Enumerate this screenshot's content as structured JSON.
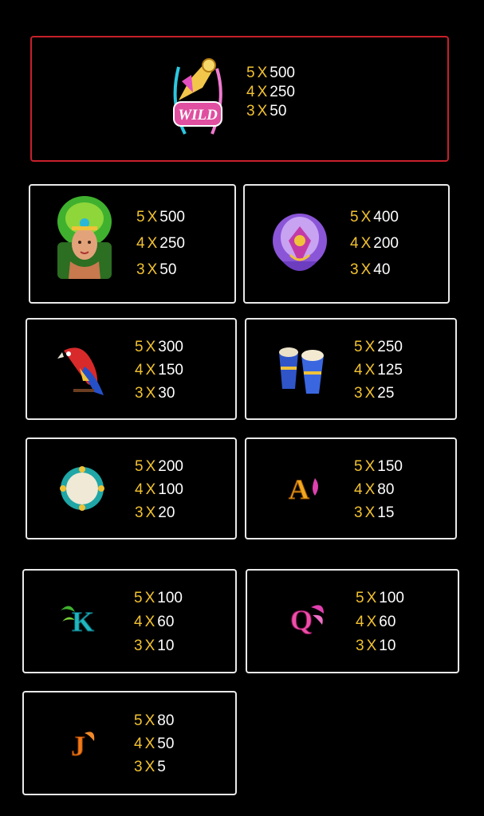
{
  "paytable": [
    {
      "symbol": "wild-icon",
      "label": "WILD",
      "pays": [
        {
          "count": "5",
          "multiplier": "X",
          "value": "500"
        },
        {
          "count": "4",
          "multiplier": "X",
          "value": "250"
        },
        {
          "count": "3",
          "multiplier": "X",
          "value": "50"
        }
      ]
    },
    {
      "symbol": "carnival-dancer-icon",
      "pays": [
        {
          "count": "5",
          "multiplier": "X",
          "value": "500"
        },
        {
          "count": "4",
          "multiplier": "X",
          "value": "250"
        },
        {
          "count": "3",
          "multiplier": "X",
          "value": "50"
        }
      ]
    },
    {
      "symbol": "feather-headdress-icon",
      "pays": [
        {
          "count": "5",
          "multiplier": "X",
          "value": "400"
        },
        {
          "count": "4",
          "multiplier": "X",
          "value": "200"
        },
        {
          "count": "3",
          "multiplier": "X",
          "value": "40"
        }
      ]
    },
    {
      "symbol": "parrot-icon",
      "pays": [
        {
          "count": "5",
          "multiplier": "X",
          "value": "300"
        },
        {
          "count": "4",
          "multiplier": "X",
          "value": "150"
        },
        {
          "count": "3",
          "multiplier": "X",
          "value": "30"
        }
      ]
    },
    {
      "symbol": "conga-drums-icon",
      "pays": [
        {
          "count": "5",
          "multiplier": "X",
          "value": "250"
        },
        {
          "count": "4",
          "multiplier": "X",
          "value": "125"
        },
        {
          "count": "3",
          "multiplier": "X",
          "value": "25"
        }
      ]
    },
    {
      "symbol": "tambourine-icon",
      "pays": [
        {
          "count": "5",
          "multiplier": "X",
          "value": "200"
        },
        {
          "count": "4",
          "multiplier": "X",
          "value": "100"
        },
        {
          "count": "3",
          "multiplier": "X",
          "value": "20"
        }
      ]
    },
    {
      "symbol": "letter-a-icon",
      "label": "A",
      "pays": [
        {
          "count": "5",
          "multiplier": "X",
          "value": "150"
        },
        {
          "count": "4",
          "multiplier": "X",
          "value": "80"
        },
        {
          "count": "3",
          "multiplier": "X",
          "value": "15"
        }
      ]
    },
    {
      "symbol": "letter-k-icon",
      "label": "K",
      "pays": [
        {
          "count": "5",
          "multiplier": "X",
          "value": "100"
        },
        {
          "count": "4",
          "multiplier": "X",
          "value": "60"
        },
        {
          "count": "3",
          "multiplier": "X",
          "value": "10"
        }
      ]
    },
    {
      "symbol": "letter-q-icon",
      "label": "Q",
      "pays": [
        {
          "count": "5",
          "multiplier": "X",
          "value": "100"
        },
        {
          "count": "4",
          "multiplier": "X",
          "value": "60"
        },
        {
          "count": "3",
          "multiplier": "X",
          "value": "10"
        }
      ]
    },
    {
      "symbol": "letter-j-icon",
      "label": "J",
      "pays": [
        {
          "count": "5",
          "multiplier": "X",
          "value": "80"
        },
        {
          "count": "4",
          "multiplier": "X",
          "value": "50"
        },
        {
          "count": "3",
          "multiplier": "X",
          "value": "5"
        }
      ]
    }
  ],
  "colors": {
    "count_color": "#f2c230",
    "value_color": "#ffffff",
    "wild_border": "#c8202a",
    "card_border": "#e9e9e9",
    "background": "#000000"
  }
}
